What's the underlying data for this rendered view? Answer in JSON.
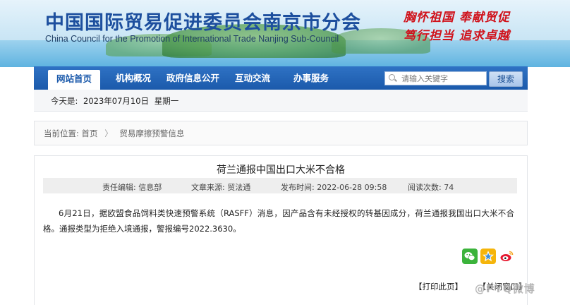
{
  "header": {
    "title_cn": "中国国际贸易促进委员会南京市分会",
    "title_en": "China Council for the Promotion of International Trade Nanjing Sub-Council",
    "slogan_line1": "胸怀祖国 奉献贸促",
    "slogan_line2": "笃行担当 追求卓越"
  },
  "nav": {
    "items": [
      {
        "label": "网站首页",
        "active": true
      },
      {
        "label": "机构概况"
      },
      {
        "label": "政府信息公开"
      },
      {
        "label": "互动交流"
      },
      {
        "label": "办事服务"
      }
    ],
    "search_placeholder": "请输入关键字",
    "search_button": "搜索"
  },
  "datebar": {
    "prefix": "今天是:",
    "date": "2023年07月10日",
    "weekday": "星期一"
  },
  "breadcrumb": {
    "label": "当前位置:",
    "home": "首页",
    "current": "贸易摩擦预警信息"
  },
  "article": {
    "title": "荷兰通报中国出口大米不合格",
    "editor": "责任编辑: 信息部",
    "source": "文章来源: 贸法通",
    "published": "发布时间: 2022-06-28 09:58",
    "views": "阅读次数: 74",
    "body": "6月21日，据欧盟食品饲料类快速预警系统（RASFF）消息，因产品含有未经授权的转基因成分，荷兰通报我国出口大米不合格。通报类型为拒绝入境通报，警报编号2022.3630。",
    "print_label": "【打印此页】",
    "close_label": "【关闭窗口】"
  },
  "share_icons": [
    "wechat-icon",
    "qzone-icon",
    "weibo-icon"
  ],
  "watermark": "@PYQ微博",
  "colors": {
    "nav_blue": "#1b5aab",
    "title_blue": "#1d4f9e",
    "slogan_red": "#d0121b"
  }
}
